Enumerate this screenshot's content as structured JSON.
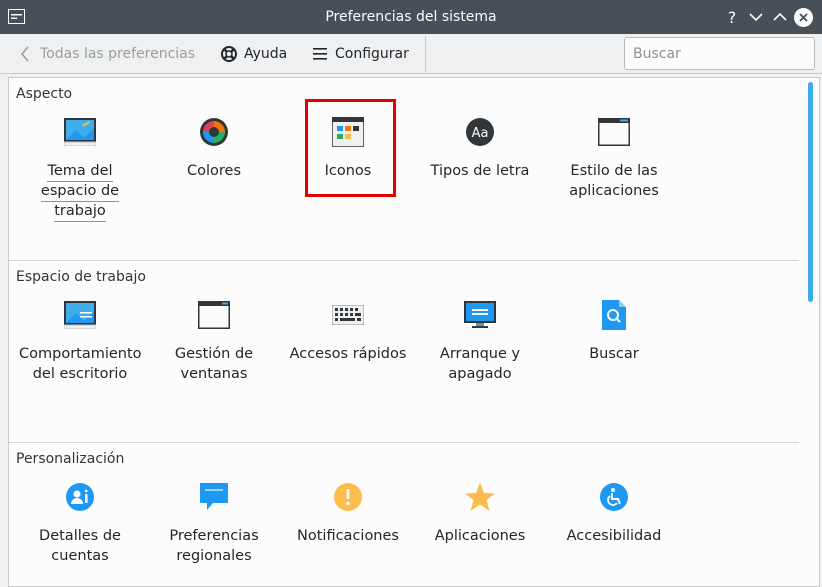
{
  "window": {
    "title": "Preferencias del sistema"
  },
  "toolbar": {
    "back_label": "Todas las preferencias",
    "help_label": "Ayuda",
    "config_label": "Configurar",
    "search_placeholder": "Buscar"
  },
  "sections": [
    {
      "title": "Aspecto",
      "items": [
        {
          "label": "Tema del espacio de trabajo",
          "icon": "workspace-theme-icon"
        },
        {
          "label": "Colores",
          "icon": "colors-icon"
        },
        {
          "label": "Iconos",
          "icon": "icons-icon"
        },
        {
          "label": "Tipos de letra",
          "icon": "fonts-icon"
        },
        {
          "label": "Estilo de las aplicaciones",
          "icon": "application-style-icon"
        }
      ]
    },
    {
      "title": "Espacio de trabajo",
      "items": [
        {
          "label": "Comportamiento del escritorio",
          "icon": "desktop-behavior-icon"
        },
        {
          "label": "Gestión de ventanas",
          "icon": "window-management-icon"
        },
        {
          "label": "Accesos rápidos",
          "icon": "shortcuts-keyboard-icon"
        },
        {
          "label": "Arranque y apagado",
          "icon": "startup-shutdown-icon"
        },
        {
          "label": "Buscar",
          "icon": "search-file-icon"
        }
      ]
    },
    {
      "title": "Personalización",
      "items": [
        {
          "label": "Detalles de cuentas",
          "icon": "account-details-icon"
        },
        {
          "label": "Preferencias regionales",
          "icon": "regional-settings-icon"
        },
        {
          "label": "Notificaciones",
          "icon": "notifications-icon"
        },
        {
          "label": "Aplicaciones",
          "icon": "applications-star-icon"
        },
        {
          "label": "Accesibilidad",
          "icon": "accessibility-icon"
        }
      ]
    }
  ],
  "colors": {
    "titlebar": "#475057",
    "accent": "#3daee9",
    "highlight": "#e50000"
  }
}
